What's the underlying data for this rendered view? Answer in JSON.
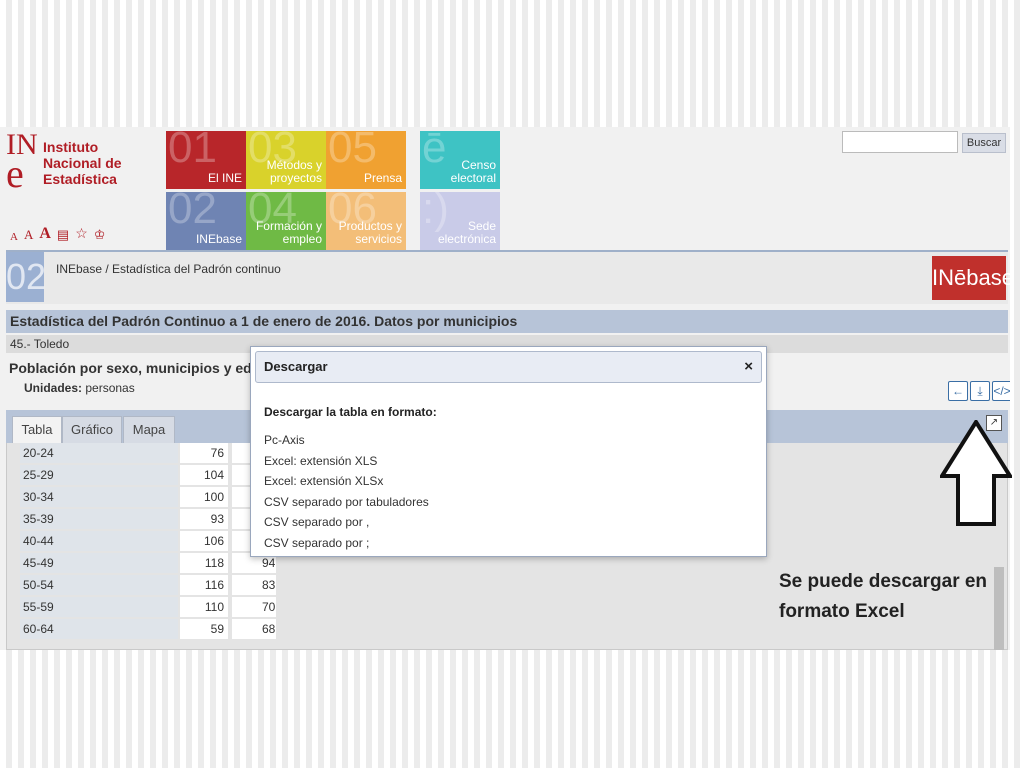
{
  "logo": {
    "mark_top": "IN",
    "mark_bottom": "e",
    "line1": "Instituto",
    "line2": "Nacional de",
    "line3": "Estadística"
  },
  "toolbar": {
    "font_small": "A",
    "font_medium": "A",
    "font_large": "A"
  },
  "tiles": [
    {
      "num": "01",
      "label": "El INE",
      "color": "#b8262a"
    },
    {
      "num": "02",
      "label": "INEbase",
      "color": "#6f84b3"
    },
    {
      "num": "03",
      "label": "Métodos y proyectos",
      "color": "#d9d22b"
    },
    {
      "num": "04",
      "label": "Formación y empleo",
      "color": "#6fba45"
    },
    {
      "num": "05",
      "label": "Prensa",
      "color": "#f0a131"
    },
    {
      "num": "06",
      "label": "Productos y servicios",
      "color": "#f3be78"
    },
    {
      "num": "ē",
      "label": "Censo electoral",
      "color": "#3ec3c4"
    },
    {
      "num": ":)",
      "label": "Sede electrónica",
      "color": "#c9cbe8"
    }
  ],
  "search": {
    "button": "Buscar",
    "placeholder": ""
  },
  "breadcrumb": {
    "num": "02",
    "path": "INEbase  /  Estadística del Padrón continuo",
    "brand": "INēbase"
  },
  "page": {
    "title": "Estadística del Padrón Continuo a 1 de enero de 2016. Datos por municipios",
    "subtitle": "45.- Toledo",
    "table_title": "Población por sexo, municipios y edad (gr",
    "units_label": "Unidades:",
    "units_value": "personas"
  },
  "tabs": [
    {
      "label": "Tabla"
    },
    {
      "label": "Gráfico"
    },
    {
      "label": "Mapa"
    }
  ],
  "rows": [
    {
      "age": "20-24",
      "v1": "76",
      "v2": ""
    },
    {
      "age": "25-29",
      "v1": "104",
      "v2": ""
    },
    {
      "age": "30-34",
      "v1": "100",
      "v2": ""
    },
    {
      "age": "35-39",
      "v1": "93",
      "v2": ""
    },
    {
      "age": "40-44",
      "v1": "106",
      "v2": ""
    },
    {
      "age": "45-49",
      "v1": "118",
      "v2": "94"
    },
    {
      "age": "50-54",
      "v1": "116",
      "v2": "83"
    },
    {
      "age": "55-59",
      "v1": "110",
      "v2": "70"
    },
    {
      "age": "60-64",
      "v1": "59",
      "v2": "68"
    }
  ],
  "dialog": {
    "title": "Descargar",
    "close": "×",
    "lead": "Descargar la tabla en formato:",
    "options": [
      "Pc-Axis",
      "Excel: extensión XLS",
      "Excel: extensión XLSx",
      "CSV separado por tabuladores",
      "CSV separado por ,",
      "CSV separado por ;"
    ]
  },
  "annotation": {
    "line1": "Se puede descargar en",
    "line2": "formato Excel"
  }
}
